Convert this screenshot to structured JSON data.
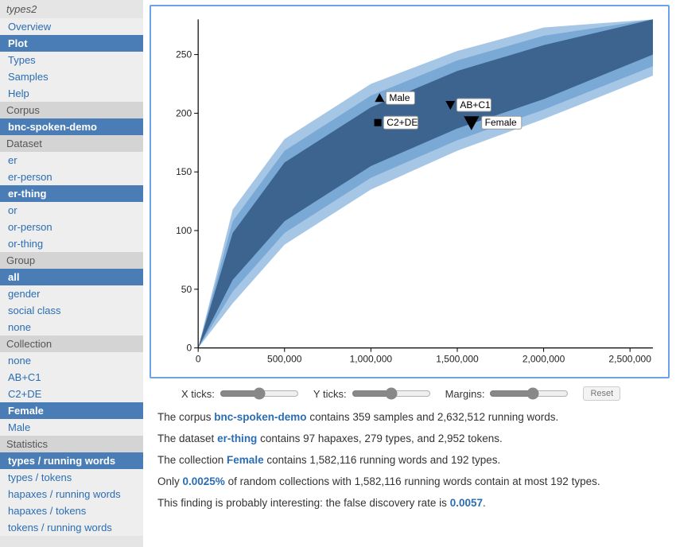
{
  "app_title": "types2",
  "nav": {
    "items": [
      {
        "label": "Overview",
        "selected": false
      },
      {
        "label": "Plot",
        "selected": true
      },
      {
        "label": "Types",
        "selected": false
      },
      {
        "label": "Samples",
        "selected": false
      },
      {
        "label": "Help",
        "selected": false
      }
    ]
  },
  "corpus": {
    "header": "Corpus",
    "items": [
      {
        "label": "bnc-spoken-demo",
        "selected": true
      }
    ]
  },
  "dataset": {
    "header": "Dataset",
    "items": [
      {
        "label": "er",
        "selected": false
      },
      {
        "label": "er-person",
        "selected": false
      },
      {
        "label": "er-thing",
        "selected": true
      },
      {
        "label": "or",
        "selected": false
      },
      {
        "label": "or-person",
        "selected": false
      },
      {
        "label": "or-thing",
        "selected": false
      }
    ]
  },
  "group": {
    "header": "Group",
    "items": [
      {
        "label": "all",
        "selected": true
      },
      {
        "label": "gender",
        "selected": false
      },
      {
        "label": "social class",
        "selected": false
      },
      {
        "label": "none",
        "selected": false
      }
    ]
  },
  "collection": {
    "header": "Collection",
    "items": [
      {
        "label": "none",
        "selected": false
      },
      {
        "label": "AB+C1",
        "selected": false
      },
      {
        "label": "C2+DE",
        "selected": false
      },
      {
        "label": "Female",
        "selected": true
      },
      {
        "label": "Male",
        "selected": false
      }
    ]
  },
  "statistics": {
    "header": "Statistics",
    "items": [
      {
        "label": "types / running words",
        "selected": true
      },
      {
        "label": "types / tokens",
        "selected": false
      },
      {
        "label": "hapaxes / running words",
        "selected": false
      },
      {
        "label": "hapaxes / tokens",
        "selected": false
      },
      {
        "label": "tokens / running words",
        "selected": false
      }
    ]
  },
  "chart_data": {
    "type": "area",
    "xlabel": "",
    "ylabel": "",
    "xlim": [
      0,
      2632512
    ],
    "ylim": [
      0,
      280
    ],
    "x_ticks": [
      0,
      500000,
      1000000,
      1500000,
      2000000,
      2500000
    ],
    "x_tick_labels": [
      "0",
      "500,000",
      "1,000,000",
      "1,500,000",
      "2,000,000",
      "2,500,000"
    ],
    "y_ticks": [
      0,
      50,
      100,
      150,
      200,
      250
    ],
    "y_tick_labels": [
      "0",
      "50",
      "100",
      "150",
      "200",
      "250"
    ],
    "bands": [
      {
        "level": "outer",
        "color": "#a6c6e6",
        "x": [
          0,
          200000,
          500000,
          1000000,
          1500000,
          2000000,
          2632512
        ],
        "y_lo": [
          0,
          38,
          88,
          135,
          168,
          195,
          232
        ],
        "y_hi": [
          0,
          118,
          178,
          225,
          253,
          273,
          280
        ]
      },
      {
        "level": "mid",
        "color": "#7aa9d6",
        "x": [
          0,
          200000,
          500000,
          1000000,
          1500000,
          2000000,
          2632512
        ],
        "y_lo": [
          0,
          48,
          98,
          145,
          177,
          203,
          240
        ],
        "y_hi": [
          0,
          108,
          168,
          215,
          245,
          266,
          280
        ]
      },
      {
        "level": "inner",
        "color": "#3c648f",
        "x": [
          0,
          200000,
          500000,
          1000000,
          1500000,
          2000000,
          2632512
        ],
        "y_lo": [
          0,
          58,
          108,
          155,
          187,
          212,
          250
        ],
        "y_hi": [
          0,
          98,
          158,
          205,
          236,
          258,
          280
        ]
      }
    ],
    "markers": [
      {
        "label": "Male",
        "x": 1050404,
        "y": 213,
        "shape": "triangle-up",
        "size": 10
      },
      {
        "label": "C2+DE",
        "x": 1040000,
        "y": 192,
        "shape": "square",
        "size": 9
      },
      {
        "label": "AB+C1",
        "x": 1460000,
        "y": 207,
        "shape": "triangle-down",
        "size": 10
      },
      {
        "label": "Female",
        "x": 1582116,
        "y": 192,
        "shape": "triangle-down",
        "size": 16
      }
    ]
  },
  "controls": {
    "x_ticks": {
      "label": "X ticks:",
      "value": 50
    },
    "y_ticks": {
      "label": "Y ticks:",
      "value": 50
    },
    "margins": {
      "label": "Margins:",
      "value": 55
    },
    "reset": "Reset"
  },
  "summary": {
    "l1_a": "The corpus ",
    "l1_link": "bnc-spoken-demo",
    "l1_b": " contains 359 samples and 2,632,512 running words.",
    "l2_a": "The dataset ",
    "l2_link": "er-thing",
    "l2_b": " contains 97 hapaxes, 279 types, and 2,952 tokens.",
    "l3_a": "The collection ",
    "l3_link": "Female",
    "l3_b": " contains 1,582,116 running words and 192 types.",
    "l4_a": "Only ",
    "l4_link": "0.0025%",
    "l4_b": " of random collections with 1,582,116 running words contain at most 192 types.",
    "l5_a": "This finding is probably interesting: the false discovery rate is ",
    "l5_link": "0.0057",
    "l5_b": "."
  }
}
